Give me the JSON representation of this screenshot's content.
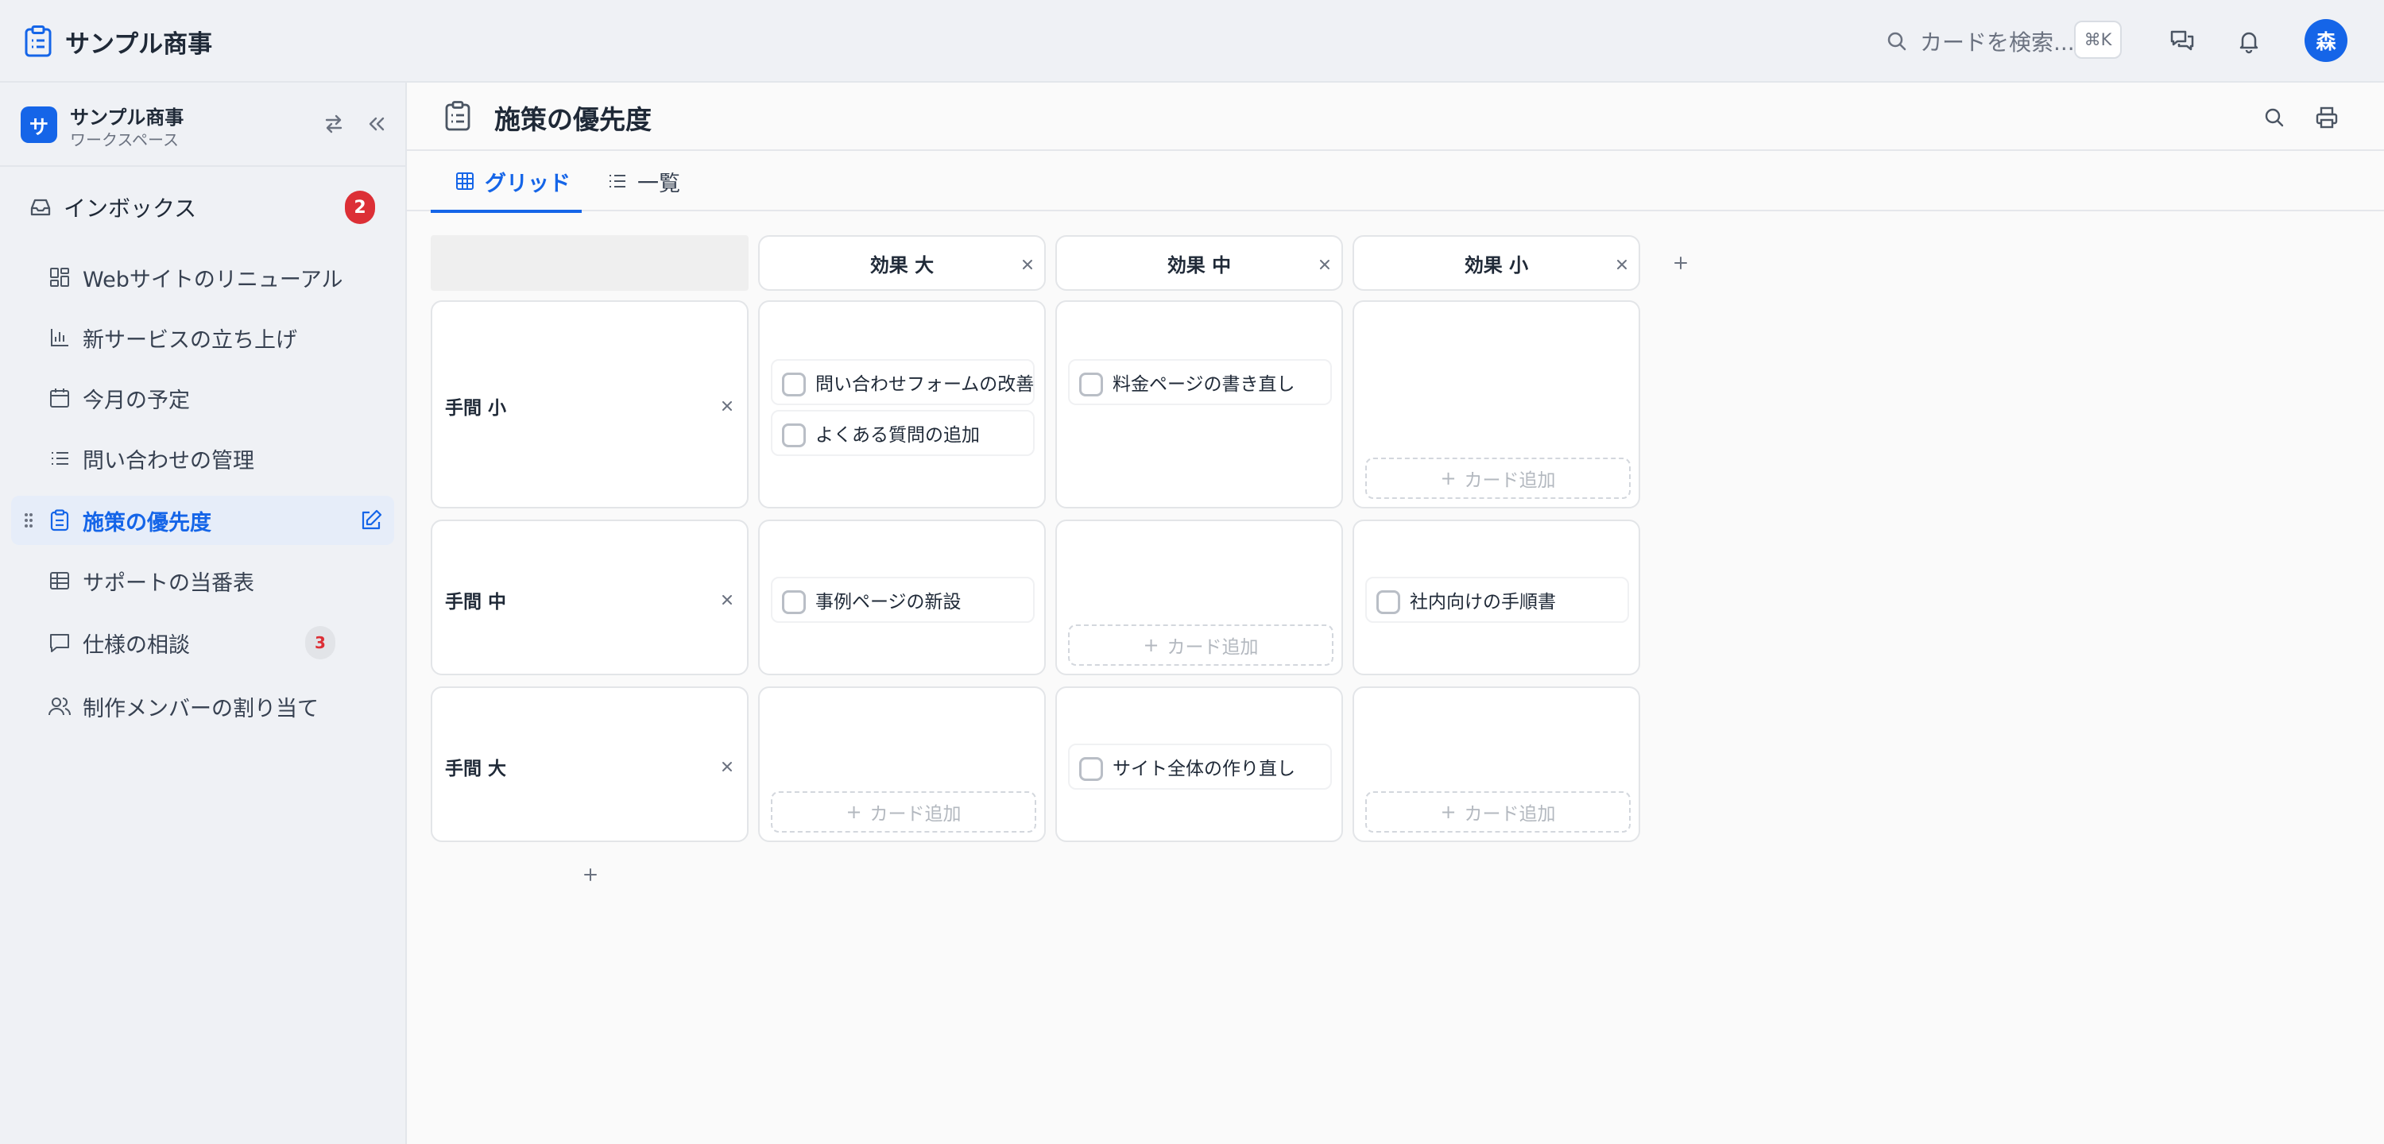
{
  "app": {
    "title": "サンプル商事"
  },
  "topbar": {
    "search_placeholder": "カードを検索...",
    "shortcut": "⌘K",
    "avatar": "森"
  },
  "workspace": {
    "logo": "サ",
    "name": "サンプル商事",
    "sub": "ワークスペース"
  },
  "sidebar": {
    "inbox": {
      "label": "インボックス",
      "badge": "2"
    },
    "items": [
      {
        "label": "Webサイトのリニューアル",
        "icon": "dashboard-icon"
      },
      {
        "label": "新サービスの立ち上げ",
        "icon": "chart-icon"
      },
      {
        "label": "今月の予定",
        "icon": "calendar-icon"
      },
      {
        "label": "問い合わせの管理",
        "icon": "list-icon"
      },
      {
        "label": "施策の優先度",
        "icon": "clipboard-icon",
        "active": true
      },
      {
        "label": "サポートの当番表",
        "icon": "table-icon"
      },
      {
        "label": "仕様の相談",
        "icon": "chat-icon",
        "badge": "3"
      },
      {
        "label": "制作メンバーの割り当て",
        "icon": "users-icon"
      }
    ]
  },
  "page": {
    "title": "施策の優先度"
  },
  "tabs": [
    {
      "label": "グリッド",
      "active": true
    },
    {
      "label": "一覧"
    }
  ],
  "grid": {
    "columns": [
      "効果 大",
      "効果 中",
      "効果 小"
    ],
    "rows": [
      "手間 小",
      "手間 中",
      "手間 大"
    ],
    "add_card_label": "カード追加",
    "add_plus": "+",
    "cells": [
      [
        [
          "問い合わせフォームの改善",
          "よくある質問の追加"
        ],
        [
          "料金ページの書き直し"
        ],
        []
      ],
      [
        [
          "事例ページの新設"
        ],
        [],
        [
          "社内向けの手順書"
        ]
      ],
      [
        [],
        [
          "サイト全体の作り直し"
        ],
        []
      ]
    ]
  },
  "colors": {
    "accent": "#1565e8",
    "badge": "#dc2f36"
  }
}
